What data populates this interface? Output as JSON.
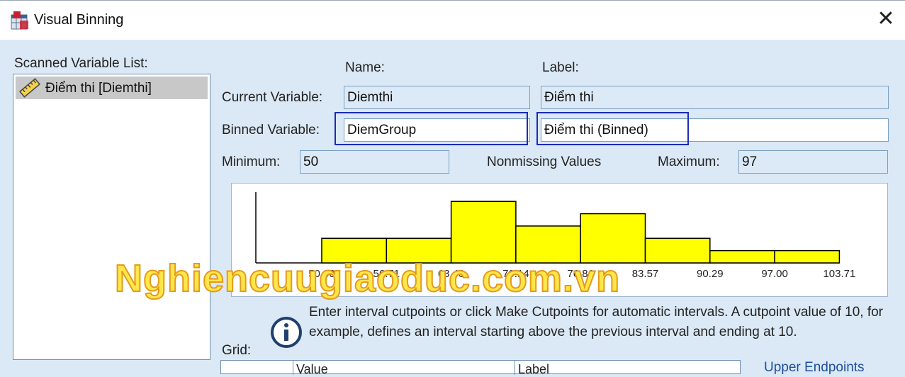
{
  "window": {
    "title": "Visual Binning",
    "close_glyph": "✕"
  },
  "scanned": {
    "label": "Scanned Variable List:",
    "items": [
      {
        "label": "Điểm thi [Diemthi]",
        "icon": "ruler-icon"
      }
    ]
  },
  "headers": {
    "name": "Name:",
    "label": "Label:"
  },
  "current_variable": {
    "label": "Current Variable:",
    "name": "Diemthi",
    "var_label": "Điểm thi"
  },
  "binned_variable": {
    "label": "Binned Variable:",
    "name": "DiemGroup",
    "var_label": "Điểm thi (Binned)"
  },
  "minimum": {
    "label": "Minimum:",
    "value": "50"
  },
  "nonmissing": {
    "label": "Nonmissing Values"
  },
  "maximum": {
    "label": "Maximum:",
    "value": "97"
  },
  "chart_data": {
    "type": "bar",
    "tick_labels": [
      "50.00",
      "56.71",
      "63.43",
      "70.14",
      "76.86",
      "83.57",
      "90.29",
      "97.00",
      "103.71"
    ],
    "values": [
      2,
      2,
      5,
      3,
      4,
      2,
      1,
      1
    ],
    "ylim": [
      0,
      5.3
    ]
  },
  "watermark": "Nghiencuugiaoduc.com.vn",
  "info": {
    "icon": "info-icon",
    "text": "Enter interval cutpoints or click Make Cutpoints for automatic intervals. A cutpoint value of 10, for example, defines an interval starting above the previous interval and ending at 10."
  },
  "grid": {
    "label": "Grid:",
    "headers": [
      "",
      "Value",
      "Label"
    ]
  },
  "upper_endpoints": "Upper Endpoints"
}
